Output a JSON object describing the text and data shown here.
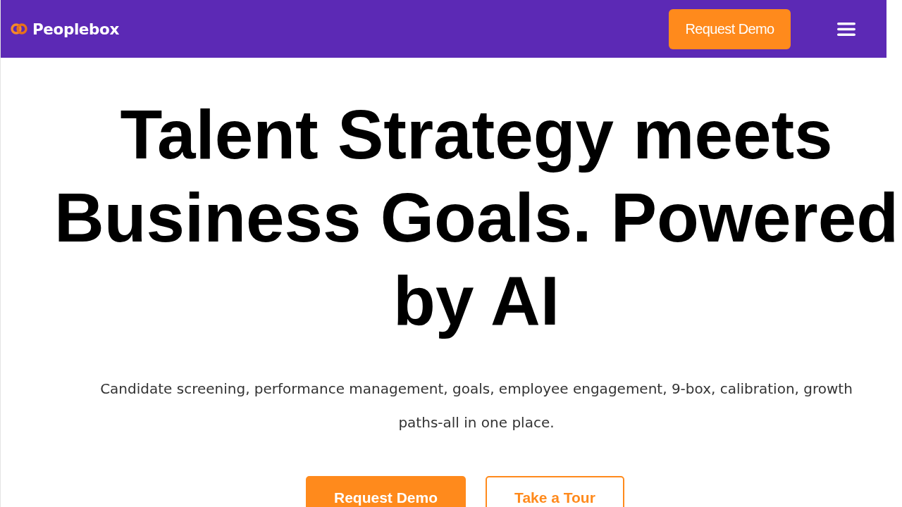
{
  "header": {
    "brand": "Peoplebox",
    "cta": "Request Demo"
  },
  "hero": {
    "headline": "Talent Strategy meets Business Goals. Powered by AI",
    "subtitle": "Candidate screening, performance management, goals, employee engagement, 9-box, calibration, growth paths-all in one place.",
    "buttons": [
      {
        "label": "Request Demo",
        "kind": "primary"
      },
      {
        "label": "Take a Tour",
        "kind": "outline"
      }
    ]
  }
}
